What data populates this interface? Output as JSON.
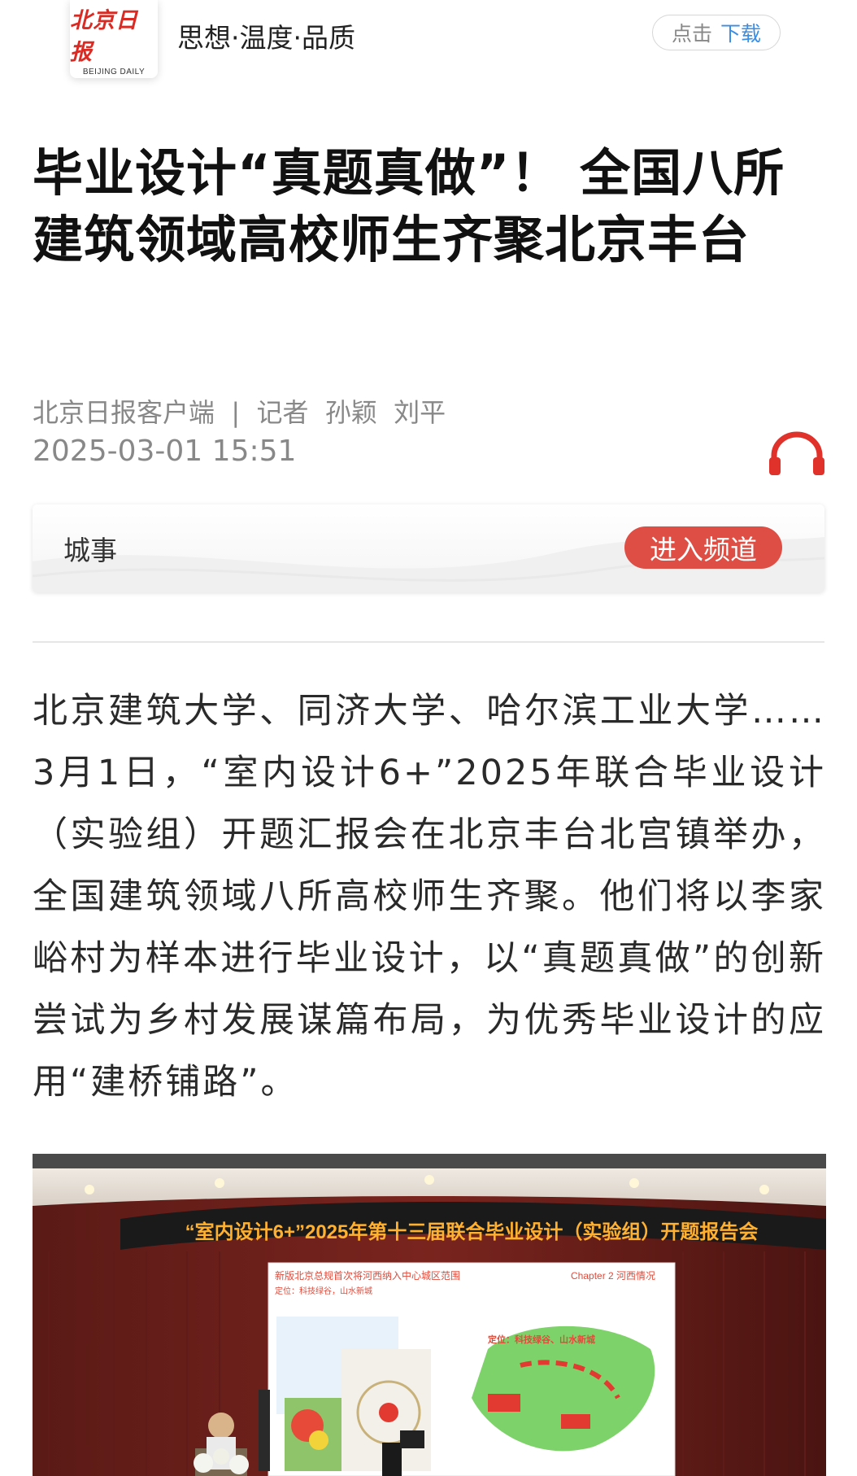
{
  "header": {
    "logo_cn": "北京日报",
    "logo_en": "BEIJING DAILY",
    "slogan": "思想·温度·品质",
    "download_prefix": "点击",
    "download_label": "下载"
  },
  "article": {
    "title": "毕业设计“真题真做”！ 全国八所建筑领域高校师生齐聚北京丰台",
    "source_line": "北京日报客户端  |  记者  孙颖  刘平",
    "datetime": "2025-03-01  15:51",
    "body": "北京建筑大学、同济大学、哈尔滨工业大学……3月1日，“室内设计6+”2025年联合毕业设计（实验组）开题汇报会在北京丰台北宫镇举办，全国建筑领域八所高校师生齐聚。他们将以李家峪村为样本进行毕业设计，以“真题真做”的创新尝试为乡村发展谋篇布局，为优秀毕业设计的应用“建桥铺路”。"
  },
  "channel": {
    "name": "城事",
    "enter_label": "进入频道"
  },
  "photo": {
    "banner_text": "“室内设计6+”2025年第十三届联合毕业设计（实验组）开题报告会",
    "slide_title": "新版北京总规首次将河西纳入中心城区范围",
    "slide_chapter": "Chapter 2 河西情况",
    "slide_position": "定位：科技绿谷，山水新城",
    "slide_position2": "定位：科技绿谷、山水新城"
  },
  "colors": {
    "brand_red": "#d92b23",
    "button_red": "#de4e45",
    "link_blue": "#3a8ee6",
    "meta_gray": "#888888"
  },
  "icons": {
    "audio": "headphones-icon"
  }
}
